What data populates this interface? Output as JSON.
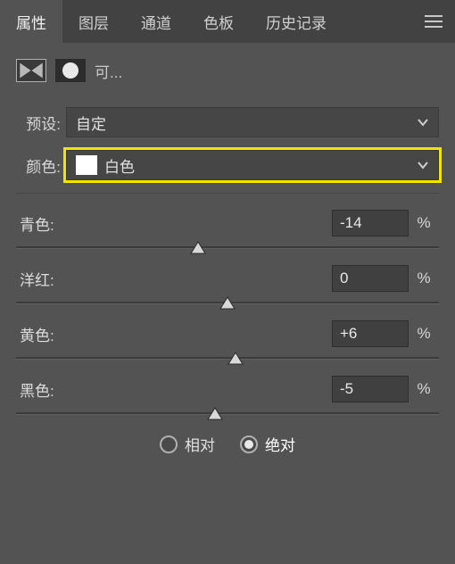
{
  "tabs": {
    "items": [
      "属性",
      "图层",
      "通道",
      "色板",
      "历史记录"
    ],
    "active": 0
  },
  "modeLabel": "可...",
  "preset": {
    "label": "预设:",
    "value": "自定"
  },
  "colors": {
    "label": "颜色:",
    "swatch": "#ffffff",
    "name": "白色"
  },
  "sliders": [
    {
      "label": "青色:",
      "value": "-14",
      "unit": "%",
      "pos": 43
    },
    {
      "label": "洋红:",
      "value": "0",
      "unit": "%",
      "pos": 50
    },
    {
      "label": "黄色:",
      "value": "+6",
      "unit": "%",
      "pos": 52
    },
    {
      "label": "黑色:",
      "value": "-5",
      "unit": "%",
      "pos": 47
    }
  ],
  "method": {
    "options": [
      "相对",
      "绝对"
    ],
    "selected": 1
  }
}
